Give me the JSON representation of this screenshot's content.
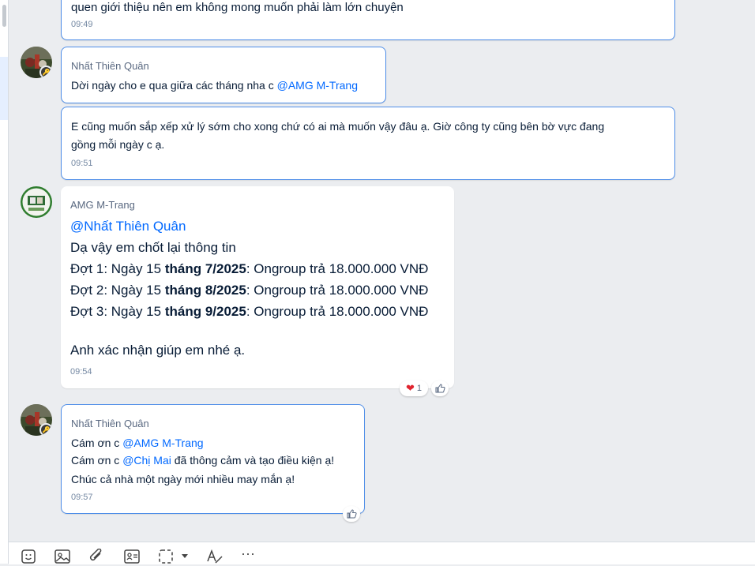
{
  "messages": [
    {
      "text": "quen giới thiệu nên em không mong muốn phải làm lớn chuyện",
      "time": "09:49"
    },
    {
      "sender": "Nhất Thiên Quân",
      "text_prefix": "Dời ngày cho e qua giữa các tháng nha c ",
      "mention": "@AMG M-Trang"
    },
    {
      "line1": "E cũng muốn sắp xếp xử lý sớm cho xong chứ có ai mà muốn vậy đâu ạ. Giờ công ty cũng bên bờ vực đang",
      "line2": "gồng mỗi ngày c ạ.",
      "time": "09:51"
    },
    {
      "sender": "AMG M-Trang",
      "mention": "@Nhất Thiên Quân",
      "line1": "Dạ vậy em chốt lại thông tin",
      "rows": [
        {
          "lead": "Đợt 1: Ngày 15 ",
          "bold": "tháng 7/2025",
          "tail": ": Ongroup trả 18.000.000 VNĐ"
        },
        {
          "lead": "Đợt 2: Ngày 15 ",
          "bold": "tháng 8/2025",
          "tail": ": Ongroup trả 18.000.000 VNĐ"
        },
        {
          "lead": "Đợt 3: Ngày 15 ",
          "bold": "tháng 9/2025",
          "tail": ": Ongroup trả 18.000.000 VNĐ"
        }
      ],
      "closing": "Anh xác nhận giúp em nhé ạ.",
      "time": "09:54",
      "reaction_count": "1"
    },
    {
      "sender": "Nhất Thiên Quân",
      "line1_prefix": "Cám ơn c ",
      "line1_mention": "@AMG M-Trang",
      "line2_prefix": "Cám ơn c ",
      "line2_mention": "@Chị Mai",
      "line2_suffix": " đã thông cảm và tạo điều kiện ạ!",
      "line3": "Chúc cả nhà một ngày mới nhiều may mắn ạ!",
      "time": "09:57"
    }
  ],
  "icons": {
    "heart": "❤",
    "more": "···"
  },
  "colors": {
    "background": "#ebedf0",
    "mine_border": "#4f8ee8",
    "mention": "#0068ff"
  }
}
